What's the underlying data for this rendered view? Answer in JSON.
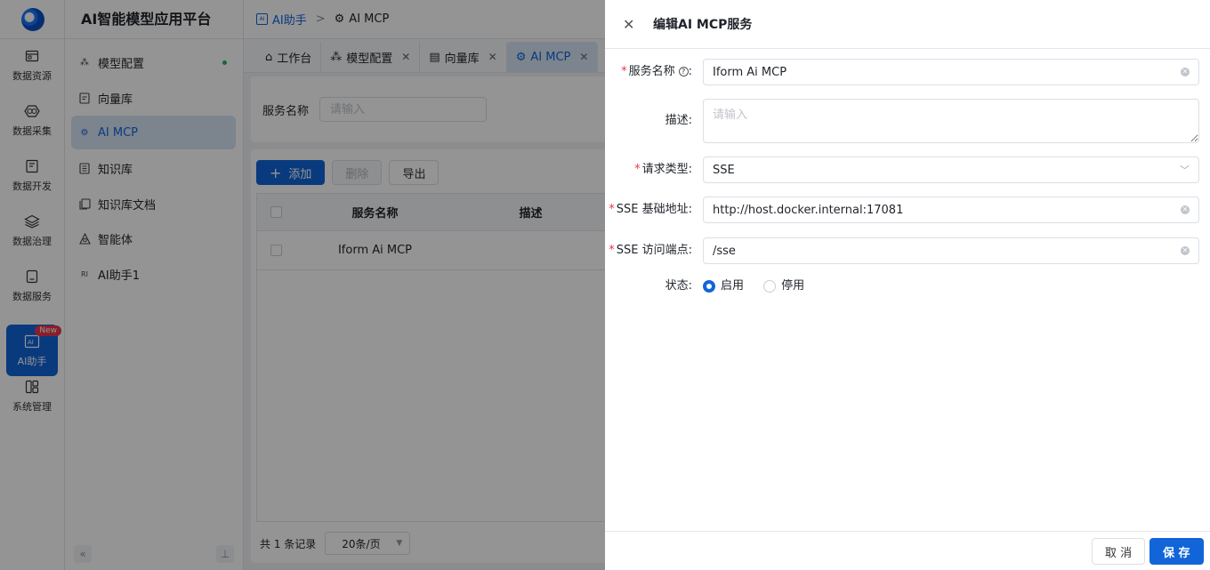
{
  "rail": {
    "items": [
      {
        "label": "数据资源",
        "icon": "database-icon"
      },
      {
        "label": "数据采集",
        "icon": "collect-icon"
      },
      {
        "label": "数据开发",
        "icon": "code-icon"
      },
      {
        "label": "数据治理",
        "icon": "layers-icon"
      },
      {
        "label": "数据服务",
        "icon": "service-icon"
      },
      {
        "label": "AI助手",
        "icon": "ai-icon",
        "active": true,
        "badge": "New"
      },
      {
        "label": "系统管理",
        "icon": "settings-grid-icon"
      }
    ]
  },
  "menu": {
    "title": "AI智能模型应用平台",
    "items": [
      {
        "label": "模型配置"
      },
      {
        "label": "向量库"
      },
      {
        "label": "AI MCP"
      },
      {
        "label": "知识库"
      },
      {
        "label": "知识库文档"
      },
      {
        "label": "智能体"
      },
      {
        "label": "AI助手1"
      }
    ],
    "collapse_glyph": "«",
    "pin_glyph": "⊥"
  },
  "breadcrumb": {
    "root": "AI助手",
    "current": "AI MCP",
    "separator": ">"
  },
  "tabs": [
    {
      "label": "工作台",
      "closable": false
    },
    {
      "label": "模型配置",
      "closable": true
    },
    {
      "label": "向量库",
      "closable": true
    },
    {
      "label": "AI MCP",
      "closable": true,
      "active": true
    }
  ],
  "filter": {
    "label": "服务名称",
    "placeholder": "请输入"
  },
  "toolbar": {
    "add": "添加",
    "delete": "删除",
    "export": "导出"
  },
  "table": {
    "headers": [
      "服务名称",
      "描述"
    ],
    "rows": [
      {
        "name": "Iform Ai MCP",
        "desc": ""
      }
    ]
  },
  "pager": {
    "total": "共 1 条记录",
    "page_size": "20条/页"
  },
  "drawer": {
    "title": "编辑AI MCP服务",
    "fields": {
      "name": {
        "label": "服务名称",
        "value": "Iform Ai MCP",
        "required": true
      },
      "desc": {
        "label": "描述",
        "placeholder": "请输入"
      },
      "type": {
        "label": "请求类型",
        "value": "SSE",
        "required": true
      },
      "base_url": {
        "label": "SSE 基础地址",
        "value": "http://host.docker.internal:17081",
        "required": true
      },
      "endpoint": {
        "label": "SSE 访问端点",
        "value": "/sse",
        "required": true
      },
      "status": {
        "label": "状态",
        "options": [
          "启用",
          "停用"
        ],
        "selected": "启用"
      }
    },
    "cancel": "取 消",
    "save": "保 存"
  },
  "colors": {
    "primary": "#1165d9",
    "required": "#e8364c",
    "active_bg": "#d6e3f5"
  }
}
